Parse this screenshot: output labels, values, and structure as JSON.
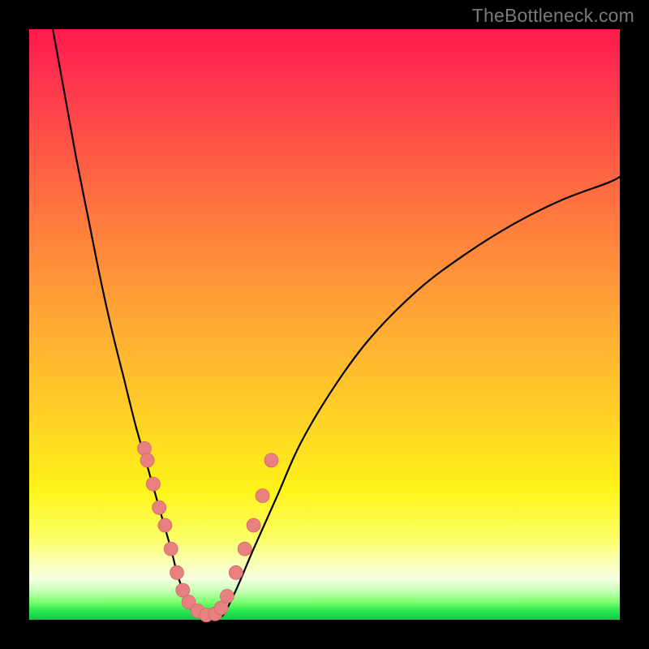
{
  "watermark": "TheBottleneck.com",
  "colors": {
    "frame": "#000000",
    "dot_fill": "#e98080",
    "dot_stroke": "#d06868",
    "curve": "#000000"
  },
  "chart_data": {
    "type": "line",
    "title": "",
    "xlabel": "",
    "ylabel": "",
    "xlim": [
      0,
      100
    ],
    "ylim": [
      0,
      100
    ],
    "note": "Values are read as percentages of the plot area. x runs left→right 0–100; y runs bottom→top 0–100 (so y=0 is the green band at the bottom, y=100 is the red top).",
    "series": [
      {
        "name": "left-branch",
        "x": [
          4,
          6,
          8,
          10,
          12,
          14,
          16,
          18,
          20,
          22,
          24,
          25,
          26,
          27,
          28
        ],
        "y": [
          100,
          89,
          78,
          68,
          58,
          49,
          41,
          33,
          26,
          19,
          12,
          8,
          5,
          2.5,
          1
        ]
      },
      {
        "name": "valley-floor",
        "x": [
          28,
          29,
          30,
          31,
          32,
          33
        ],
        "y": [
          1,
          0.6,
          0.4,
          0.4,
          0.6,
          1
        ]
      },
      {
        "name": "right-branch",
        "x": [
          33,
          35,
          38,
          42,
          46,
          52,
          58,
          66,
          74,
          82,
          90,
          98,
          100
        ],
        "y": [
          1,
          5,
          12,
          21,
          30,
          40,
          48,
          56,
          62,
          67,
          71,
          74,
          75
        ]
      }
    ],
    "scatter": {
      "name": "sample-dots",
      "points": [
        {
          "x": 19.5,
          "y": 29
        },
        {
          "x": 20.0,
          "y": 27
        },
        {
          "x": 21.0,
          "y": 23
        },
        {
          "x": 22.0,
          "y": 19
        },
        {
          "x": 23.0,
          "y": 16
        },
        {
          "x": 24.0,
          "y": 12
        },
        {
          "x": 25.0,
          "y": 8
        },
        {
          "x": 26.0,
          "y": 5
        },
        {
          "x": 27.0,
          "y": 3
        },
        {
          "x": 28.5,
          "y": 1.5
        },
        {
          "x": 30.0,
          "y": 0.8
        },
        {
          "x": 31.5,
          "y": 1
        },
        {
          "x": 32.5,
          "y": 2
        },
        {
          "x": 33.5,
          "y": 4
        },
        {
          "x": 35.0,
          "y": 8
        },
        {
          "x": 36.5,
          "y": 12
        },
        {
          "x": 38.0,
          "y": 16
        },
        {
          "x": 39.5,
          "y": 21
        },
        {
          "x": 41.0,
          "y": 27
        }
      ]
    }
  }
}
